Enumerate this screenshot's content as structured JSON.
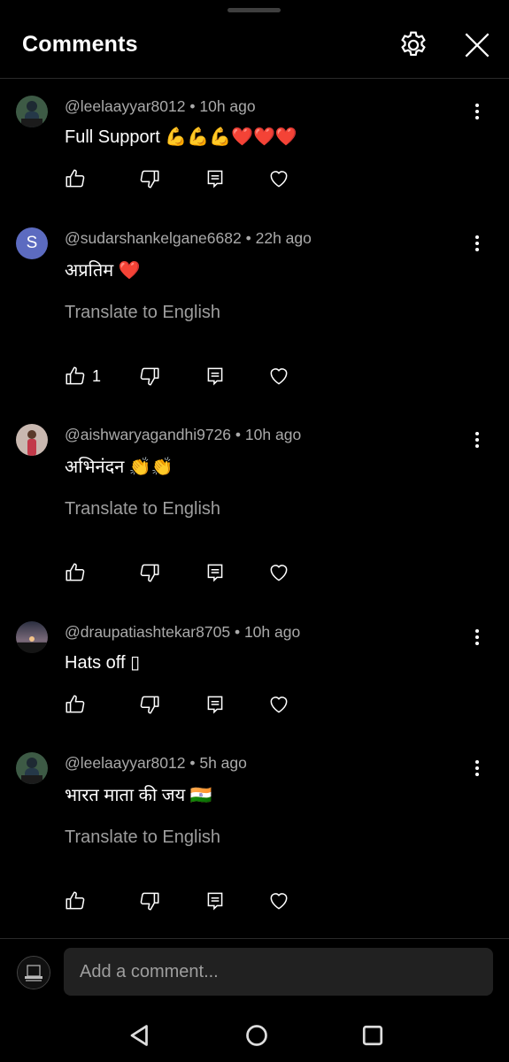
{
  "header": {
    "title": "Comments",
    "settings_icon": "gear-icon",
    "close_icon": "close-icon"
  },
  "comments": [
    {
      "handle": "@leelaayyar8012",
      "time": "10h ago",
      "text": "Full Support",
      "emoji": "💪💪💪❤️❤️❤️",
      "likes": "",
      "translate": ""
    },
    {
      "handle": "@sudarshankelgane6682",
      "time": "22h ago",
      "text": "अप्रतिम",
      "emoji": "❤️",
      "avatar_letter": "S",
      "likes": "1",
      "translate": "Translate to English"
    },
    {
      "handle": "@aishwaryagandhi9726",
      "time": "10h ago",
      "text": "अभिनंदन",
      "emoji": "👏👏",
      "likes": "",
      "translate": "Translate to English"
    },
    {
      "handle": "@draupatiashtekar8705",
      "time": "10h ago",
      "text": "Hats off",
      "emoji": "▯",
      "likes": "",
      "translate": ""
    },
    {
      "handle": "@leelaayyar8012",
      "time": "5h ago",
      "text": "भारत माता की जय",
      "emoji": "🇮🇳",
      "likes": "",
      "translate": "Translate to English"
    }
  ],
  "separator": "•",
  "composer": {
    "placeholder": "Add a comment..."
  },
  "colors": {
    "background": "#000000",
    "meta_text": "#aaaaaa",
    "avatar_s": "#5c6bc0"
  }
}
